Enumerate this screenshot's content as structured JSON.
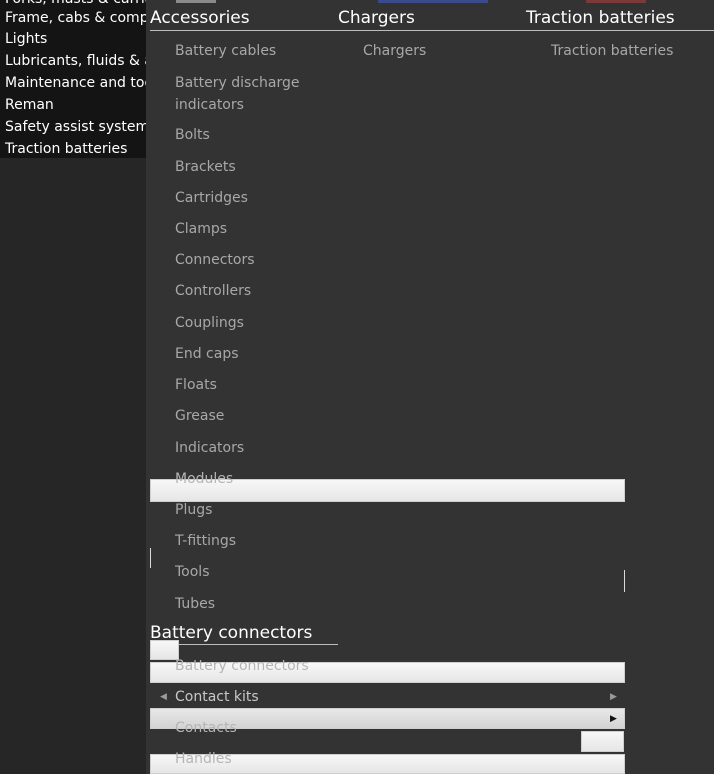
{
  "left_menu": {
    "items": [
      {
        "label": "Forks, masts & carriages"
      },
      {
        "label": "Frame, cabs & components"
      },
      {
        "label": "Lights"
      },
      {
        "label": "Lubricants, fluids & a"
      },
      {
        "label": "Maintenance and tools"
      },
      {
        "label": "Reman"
      },
      {
        "label": "Safety assist systems"
      },
      {
        "label": "Traction batteries"
      }
    ]
  },
  "columns": {
    "accessories": {
      "title": "Accessories",
      "items": [
        "Battery cables",
        "Battery discharge indicators",
        "Bolts",
        "Brackets",
        "Cartridges",
        "Clamps",
        "Connectors",
        "Controllers",
        "Couplings",
        "End caps",
        "Floats",
        "Grease",
        "Indicators",
        "Modules",
        "Plugs",
        "T-fittings",
        "Tools",
        "Tubes"
      ]
    },
    "chargers": {
      "title": "Chargers",
      "items": [
        "Chargers"
      ]
    },
    "traction": {
      "title": "Traction batteries",
      "items": [
        "Traction batteries"
      ]
    },
    "connectors": {
      "title": "Battery connectors",
      "items": [
        "Battery connectors",
        "Contact kits",
        "Contacts",
        "Handles"
      ]
    }
  },
  "colors": {
    "menu_bg": "#333333",
    "left_bg": "#141414",
    "text": "#ffffff",
    "subtext": "#a8a8a8"
  }
}
